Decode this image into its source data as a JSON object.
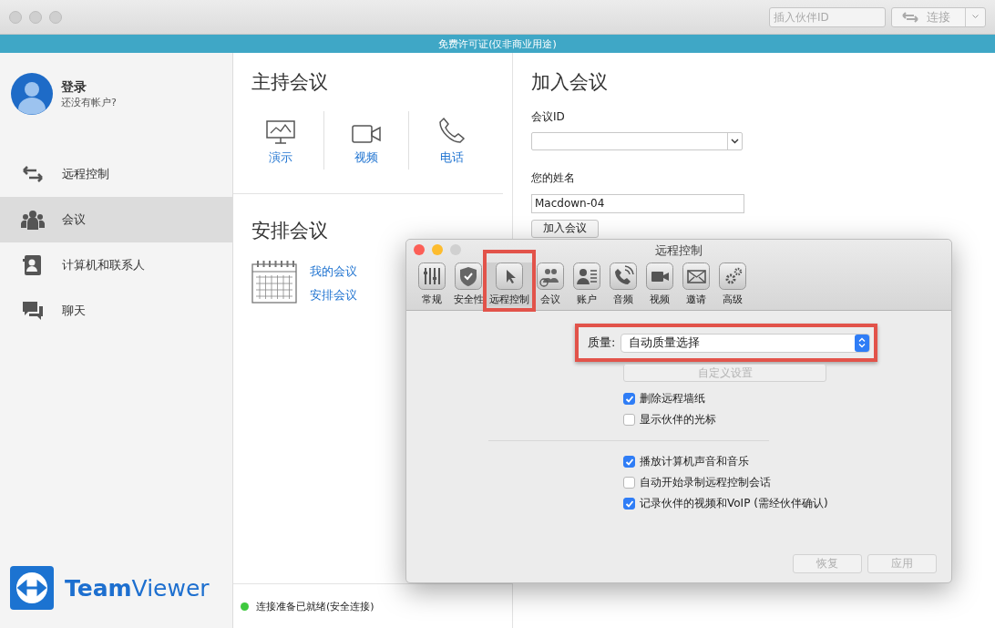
{
  "toolbar": {
    "partner_id": {
      "placeholder": "插入伙伴ID"
    },
    "connect_button": {
      "label": "连接",
      "disabled": true
    }
  },
  "banner": "免费许可证(仅非商业用途)",
  "profile": {
    "name": "登录",
    "subtitle": "还没有帐户?"
  },
  "nav": [
    {
      "label": "远程控制",
      "selected": false
    },
    {
      "label": "会议",
      "selected": true
    },
    {
      "label": "计算机和联系人",
      "selected": false
    },
    {
      "label": "聊天",
      "selected": false
    }
  ],
  "logo": "**Team**Viewer",
  "host": {
    "title": "主持会议",
    "actions": [
      "演示",
      "视频",
      "电话"
    ]
  },
  "schedule": {
    "title": "安排会议",
    "links": [
      "我的会议",
      "安排会议"
    ]
  },
  "status": {
    "text": "连接准备已就绪(安全连接)",
    "color": "#3ec93e"
  },
  "join": {
    "title": "加入会议",
    "id_label": "会议ID",
    "name_label": "您的姓名",
    "name_value": "Macdown-04",
    "button": "加入会议"
  },
  "dialog": {
    "title": "远程控制",
    "tabs": [
      {
        "label": "常规",
        "selected": false
      },
      {
        "label": "安全性",
        "selected": false
      },
      {
        "label": "远程控制",
        "selected": true
      },
      {
        "label": "会议",
        "selected": false
      },
      {
        "label": "账户",
        "selected": false
      },
      {
        "label": "音频",
        "selected": false
      },
      {
        "label": "视频",
        "selected": false
      },
      {
        "label": "邀请",
        "selected": false
      },
      {
        "label": "高级",
        "selected": false
      }
    ],
    "quality": {
      "label": "质量:",
      "value": "自动质量选择"
    },
    "custom_button": {
      "label": "自定义设置",
      "disabled": true
    },
    "options_1": [
      {
        "label": "删除远程墙纸",
        "checked": true
      },
      {
        "label": "显示伙伴的光标",
        "checked": false
      }
    ],
    "options_2": [
      {
        "label": "播放计算机声音和音乐",
        "checked": true
      },
      {
        "label": "自动开始录制远程控制会话",
        "checked": false
      },
      {
        "label": "记录伙伴的视频和VoIP (需经伙伴确认)",
        "checked": true
      }
    ],
    "buttons": [
      {
        "label": "恢复",
        "disabled": true
      },
      {
        "label": "应用",
        "disabled": true
      }
    ]
  }
}
